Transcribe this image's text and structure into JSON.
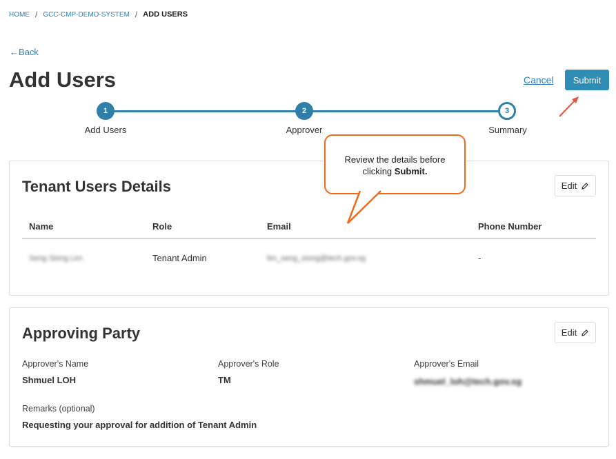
{
  "breadcrumb": {
    "home": "HOME",
    "system": "GCC-CMP-DEMO-SYSTEM",
    "current": "ADD USERS",
    "separator": "/"
  },
  "back": {
    "arrow": "←",
    "label": "Back"
  },
  "page_title": "Add Users",
  "actions": {
    "cancel": "Cancel",
    "submit": "Submit"
  },
  "steps": [
    {
      "number": "1",
      "label": "Add Users",
      "state": "done"
    },
    {
      "number": "2",
      "label": "Approver",
      "state": "done"
    },
    {
      "number": "3",
      "label": "Summary",
      "state": "current"
    }
  ],
  "callout": {
    "text": "Review the details before clicking ",
    "bold": "Submit."
  },
  "tenant_users": {
    "title": "Tenant Users Details",
    "edit": "Edit",
    "columns": {
      "name": "Name",
      "role": "Role",
      "email": "Email",
      "phone": "Phone Number"
    },
    "rows": [
      {
        "name": "Seng Siong Lim",
        "role": "Tenant Admin",
        "email": "lim_seng_siong@tech.gov.sg",
        "phone": "-"
      }
    ]
  },
  "approving_party": {
    "title": "Approving Party",
    "edit": "Edit",
    "approver_name_label": "Approver's Name",
    "approver_name": "Shmuel LOH",
    "approver_role_label": "Approver's Role",
    "approver_role": "TM",
    "approver_email_label": "Approver's Email",
    "approver_email": "shmuel_loh@tech.gov.sg",
    "remarks_label": "Remarks (optional)",
    "remarks": "Requesting your approval for addition of Tenant Admin"
  },
  "colors": {
    "accent": "#2f8cb5",
    "link": "#2f7fb8",
    "callout_border": "#f06a1e",
    "arrow": "#e8543f"
  },
  "icons": {
    "edit": "pencil-icon",
    "back": "left-arrow-icon"
  }
}
